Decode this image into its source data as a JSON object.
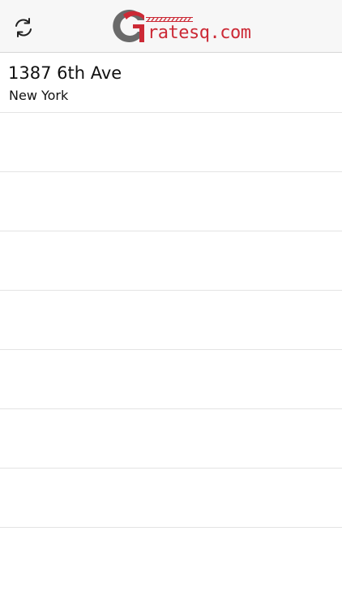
{
  "header": {
    "logo": {
      "text_part_a": "",
      "text_part_b": "ratesq.com",
      "icon": "gratesq-logo-icon",
      "colors": {
        "gray": "#555555",
        "red": "#cc2a36"
      }
    },
    "refresh_icon": "refresh-icon"
  },
  "list": {
    "items": [
      {
        "title": "1387 6th Ave",
        "subtitle": "New York"
      },
      {
        "title": "",
        "subtitle": ""
      },
      {
        "title": "",
        "subtitle": ""
      },
      {
        "title": "",
        "subtitle": ""
      },
      {
        "title": "",
        "subtitle": ""
      },
      {
        "title": "",
        "subtitle": ""
      },
      {
        "title": "",
        "subtitle": ""
      },
      {
        "title": "",
        "subtitle": ""
      }
    ]
  },
  "colors": {
    "header_bg": "#f7f7f7",
    "divider": "#e4e4e4",
    "text": "#111111"
  }
}
